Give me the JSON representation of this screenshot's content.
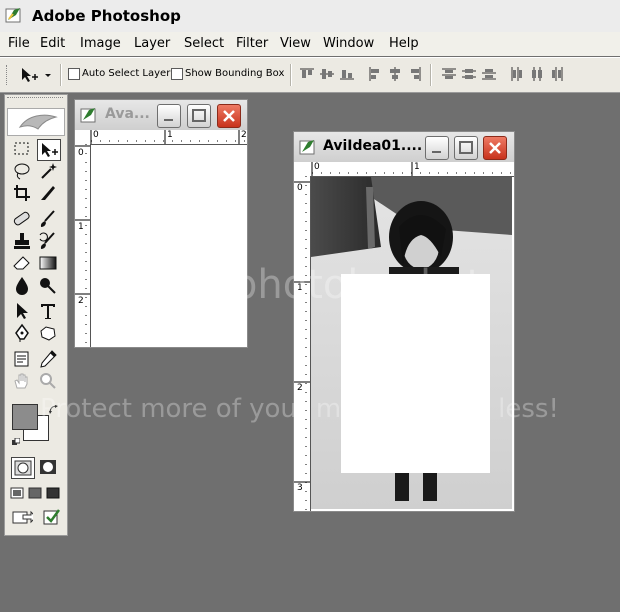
{
  "app": {
    "title": "Adobe Photoshop"
  },
  "menu": [
    "File",
    "Edit",
    "Image",
    "Layer",
    "Select",
    "Filter",
    "View",
    "Window",
    "Help"
  ],
  "options": {
    "auto_select_layer": "Auto Select Layer",
    "show_bounding_box": "Show Bounding Box"
  },
  "windows": {
    "small": {
      "title": "Ava...",
      "ruler_h": [
        "0",
        "1",
        "2"
      ],
      "ruler_v": [
        "0",
        "1",
        "2"
      ]
    },
    "main": {
      "title": "AviIdea01....",
      "ruler_h": [
        "0",
        "1"
      ],
      "ruler_v": [
        "0",
        "1",
        "2",
        "3"
      ]
    }
  },
  "watermark": {
    "line1": "Protect more of your memories for less!",
    "brand": "photobucket"
  },
  "colors": {
    "foreground": "#8c8c8c",
    "background": "#ffffff",
    "workspace": "#6f6f6f",
    "close": "#d8432a"
  }
}
